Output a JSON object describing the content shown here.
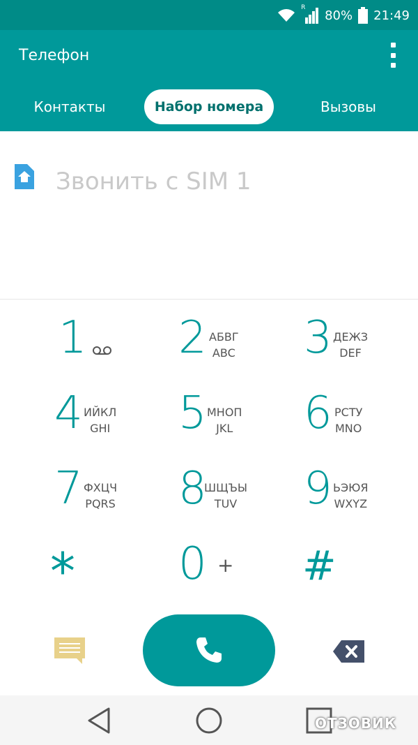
{
  "status": {
    "battery": "80%",
    "time": "21:49",
    "roaming_indicator": "R",
    "icons": [
      "wifi-icon",
      "signal-icon",
      "battery-icon"
    ]
  },
  "app": {
    "title": "Телефон",
    "menu_icon": "overflow-menu-icon"
  },
  "tabs": [
    {
      "label": "Контакты",
      "selected": false
    },
    {
      "label": "Набор номера",
      "selected": true
    },
    {
      "label": "Вызовы",
      "selected": false
    }
  ],
  "number_field": {
    "placeholder": "Звонить с SIM 1",
    "sim_icon": "sim-card-icon"
  },
  "keypad": {
    "keys": [
      {
        "digit": "1",
        "line1": "",
        "line2": "",
        "extra": "voicemail-icon"
      },
      {
        "digit": "2",
        "line1": "АБВГ",
        "line2": "ABC"
      },
      {
        "digit": "3",
        "line1": "ДЕЖЗ",
        "line2": "DEF"
      },
      {
        "digit": "4",
        "line1": "ИЙКЛ",
        "line2": "GHI"
      },
      {
        "digit": "5",
        "line1": "МНОП",
        "line2": "JKL"
      },
      {
        "digit": "6",
        "line1": "РСТУ",
        "line2": "MNO"
      },
      {
        "digit": "7",
        "line1": "ФХЦЧ",
        "line2": "PQRS"
      },
      {
        "digit": "8",
        "line1": "ШЩЪЫ",
        "line2": "TUV"
      },
      {
        "digit": "9",
        "line1": "ЬЭЮЯ",
        "line2": "WXYZ"
      }
    ],
    "star": "*",
    "zero": "0",
    "zero_extra": "+",
    "hash": "#"
  },
  "actions": {
    "message_icon": "message-icon",
    "call_icon": "phone-icon",
    "backspace_icon": "backspace-icon"
  },
  "nav": {
    "icons": [
      "back-icon",
      "home-icon",
      "recents-icon"
    ]
  },
  "watermark": "ОТЗОВИК",
  "colors": {
    "status_bar": "#008b87",
    "app_bar": "#00999a",
    "accent": "#00999a",
    "message_icon": "#e8d18a",
    "backspace": "#44506a"
  }
}
